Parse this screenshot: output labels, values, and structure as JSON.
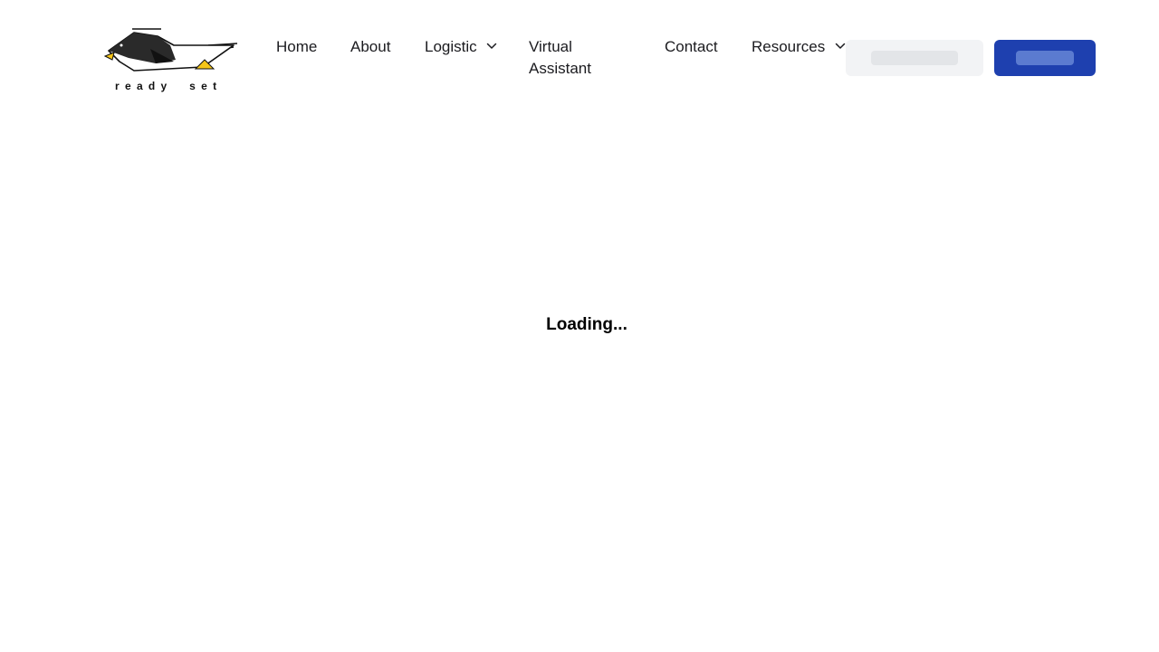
{
  "brand": {
    "logo_text": "ready set",
    "logo_icon": "penguin-bird-icon"
  },
  "nav": {
    "home": "Home",
    "about": "About",
    "logistic": "Logistic",
    "virtual_assistant": "Virtual Assistant",
    "contact": "Contact",
    "resources": "Resources",
    "dropdown_icon": "chevron-down-icon"
  },
  "status": {
    "loading": "Loading..."
  },
  "colors": {
    "primary": "#1e40af",
    "skeleton_light": "#f2f3f5",
    "accent_yellow": "#f5c518"
  }
}
